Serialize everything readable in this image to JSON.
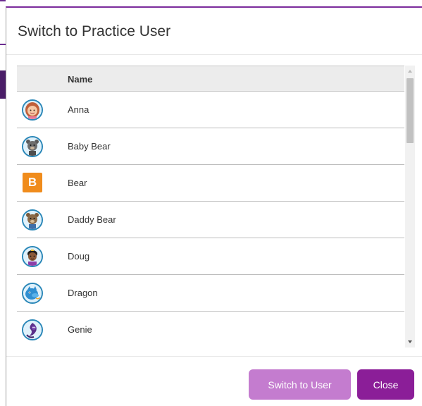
{
  "modal": {
    "title": "Switch to Practice User",
    "column_header": "Name",
    "users": [
      {
        "name": "Anna",
        "avatar": "girl-avatar-icon"
      },
      {
        "name": "Baby Bear",
        "avatar": "bear-avatar-icon"
      },
      {
        "name": "Bear",
        "avatar": "letter-b-avatar",
        "letter": "B"
      },
      {
        "name": "Daddy Bear",
        "avatar": "bear-avatar-icon"
      },
      {
        "name": "Doug",
        "avatar": "boy-avatar-icon"
      },
      {
        "name": "Dragon",
        "avatar": "dragon-avatar-icon"
      },
      {
        "name": "Genie",
        "avatar": "genie-avatar-icon"
      }
    ],
    "buttons": {
      "switch_label": "Switch to User",
      "close_label": "Close"
    }
  },
  "colors": {
    "accent": "#8b1e98",
    "accent_disabled": "#c47ccf",
    "avatar_ring": "#2a87b8",
    "letter_avatar_bg": "#f08c1c"
  }
}
